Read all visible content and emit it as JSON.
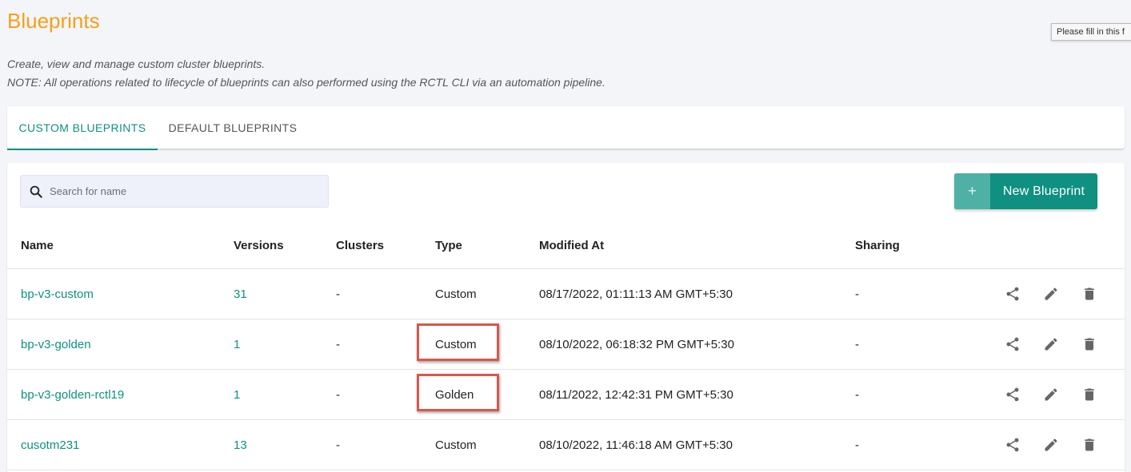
{
  "page": {
    "title": "Blueprints",
    "description_line1": "Create, view and manage custom cluster blueprints.",
    "description_line2": "NOTE: All operations related to lifecycle of blueprints can also performed using the RCTL CLI via an automation pipeline.",
    "tooltip": "Please fill in this f"
  },
  "tabs": [
    {
      "label": "CUSTOM BLUEPRINTS",
      "active": true
    },
    {
      "label": "DEFAULT BLUEPRINTS",
      "active": false
    }
  ],
  "search": {
    "placeholder": "Search for name",
    "value": ""
  },
  "new_button": {
    "icon": "+",
    "label": "New Blueprint"
  },
  "table": {
    "headers": {
      "name": "Name",
      "versions": "Versions",
      "clusters": "Clusters",
      "type": "Type",
      "modified": "Modified At",
      "sharing": "Sharing"
    },
    "rows": [
      {
        "name": "bp-v3-custom",
        "versions": "31",
        "clusters": "-",
        "type": "Custom",
        "modified": "08/17/2022, 01:11:13 AM GMT+5:30",
        "sharing": "-",
        "highlight": false
      },
      {
        "name": "bp-v3-golden",
        "versions": "1",
        "clusters": "-",
        "type": "Custom",
        "modified": "08/10/2022, 06:18:32 PM GMT+5:30",
        "sharing": "-",
        "highlight": true
      },
      {
        "name": "bp-v3-golden-rctl19",
        "versions": "1",
        "clusters": "-",
        "type": "Golden",
        "modified": "08/11/2022, 12:42:31 PM GMT+5:30",
        "sharing": "-",
        "highlight": true
      },
      {
        "name": "cusotm231",
        "versions": "13",
        "clusters": "-",
        "type": "Custom",
        "modified": "08/10/2022, 11:46:18 AM GMT+5:30",
        "sharing": "-",
        "highlight": false
      }
    ]
  },
  "icons": {
    "share": "share-icon",
    "edit": "pencil-icon",
    "delete": "trash-icon",
    "search": "search-icon"
  },
  "colors": {
    "accent": "#0f9080",
    "title": "#f5a018",
    "highlight": "#d9574c"
  }
}
